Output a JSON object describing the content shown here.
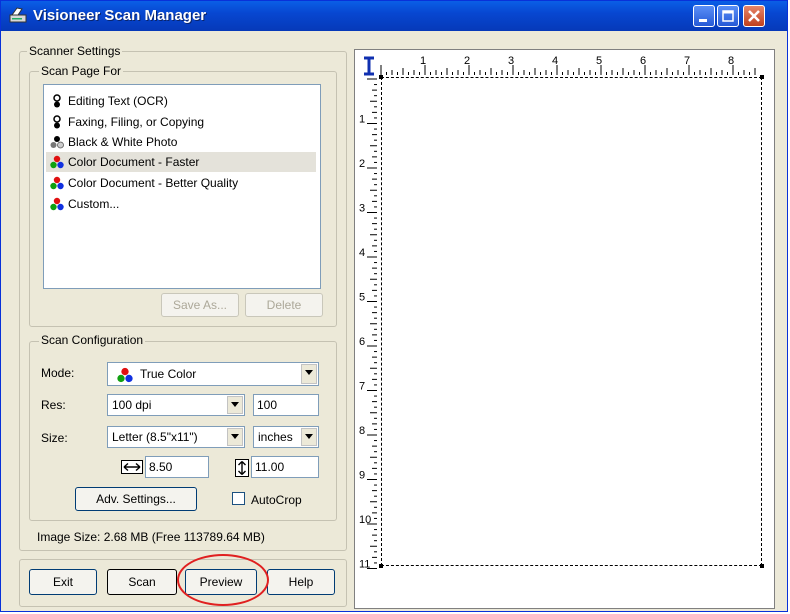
{
  "window": {
    "title": "Visioneer Scan Manager"
  },
  "scanner_settings": {
    "group_label": "Scanner Settings",
    "scan_page_for": {
      "label": "Scan Page For",
      "items": [
        {
          "label": "Editing Text (OCR)",
          "icon": "bw-icon"
        },
        {
          "label": "Faxing, Filing, or Copying",
          "icon": "bw-icon"
        },
        {
          "label": "Black & White Photo",
          "icon": "grayscale-icon"
        },
        {
          "label": "Color Document - Faster",
          "icon": "color-icon",
          "selected": true
        },
        {
          "label": "Color Document - Better Quality",
          "icon": "color-icon"
        },
        {
          "label": "Custom...",
          "icon": "color-icon"
        }
      ],
      "save_as_label": "Save As...",
      "delete_label": "Delete"
    },
    "scan_configuration": {
      "label": "Scan Configuration",
      "mode_label": "Mode:",
      "mode_value": "True Color",
      "res_label": "Res:",
      "res_value": "100 dpi",
      "res_edit": "100",
      "size_label": "Size:",
      "size_value": "Letter (8.5\"x11\")",
      "units_value": "inches",
      "width_value": "8.50",
      "height_value": "11.00",
      "adv_settings_label": "Adv. Settings...",
      "autocrop_label": "AutoCrop"
    },
    "image_size": "Image Size: 2.68 MB (Free 113789.64 MB)"
  },
  "buttons": {
    "exit": "Exit",
    "scan": "Scan",
    "preview": "Preview",
    "help": "Help"
  },
  "ruler": {
    "h_labels": [
      "1",
      "2",
      "3",
      "4",
      "5",
      "6",
      "7",
      "8"
    ],
    "v_labels": [
      "1",
      "2",
      "3",
      "4",
      "5",
      "6",
      "7",
      "8",
      "9",
      "10",
      "11"
    ]
  },
  "colors": {
    "title_bar": "#0747d1",
    "annotation_circle": "#e02020",
    "window_bg": "#ece9d8"
  }
}
